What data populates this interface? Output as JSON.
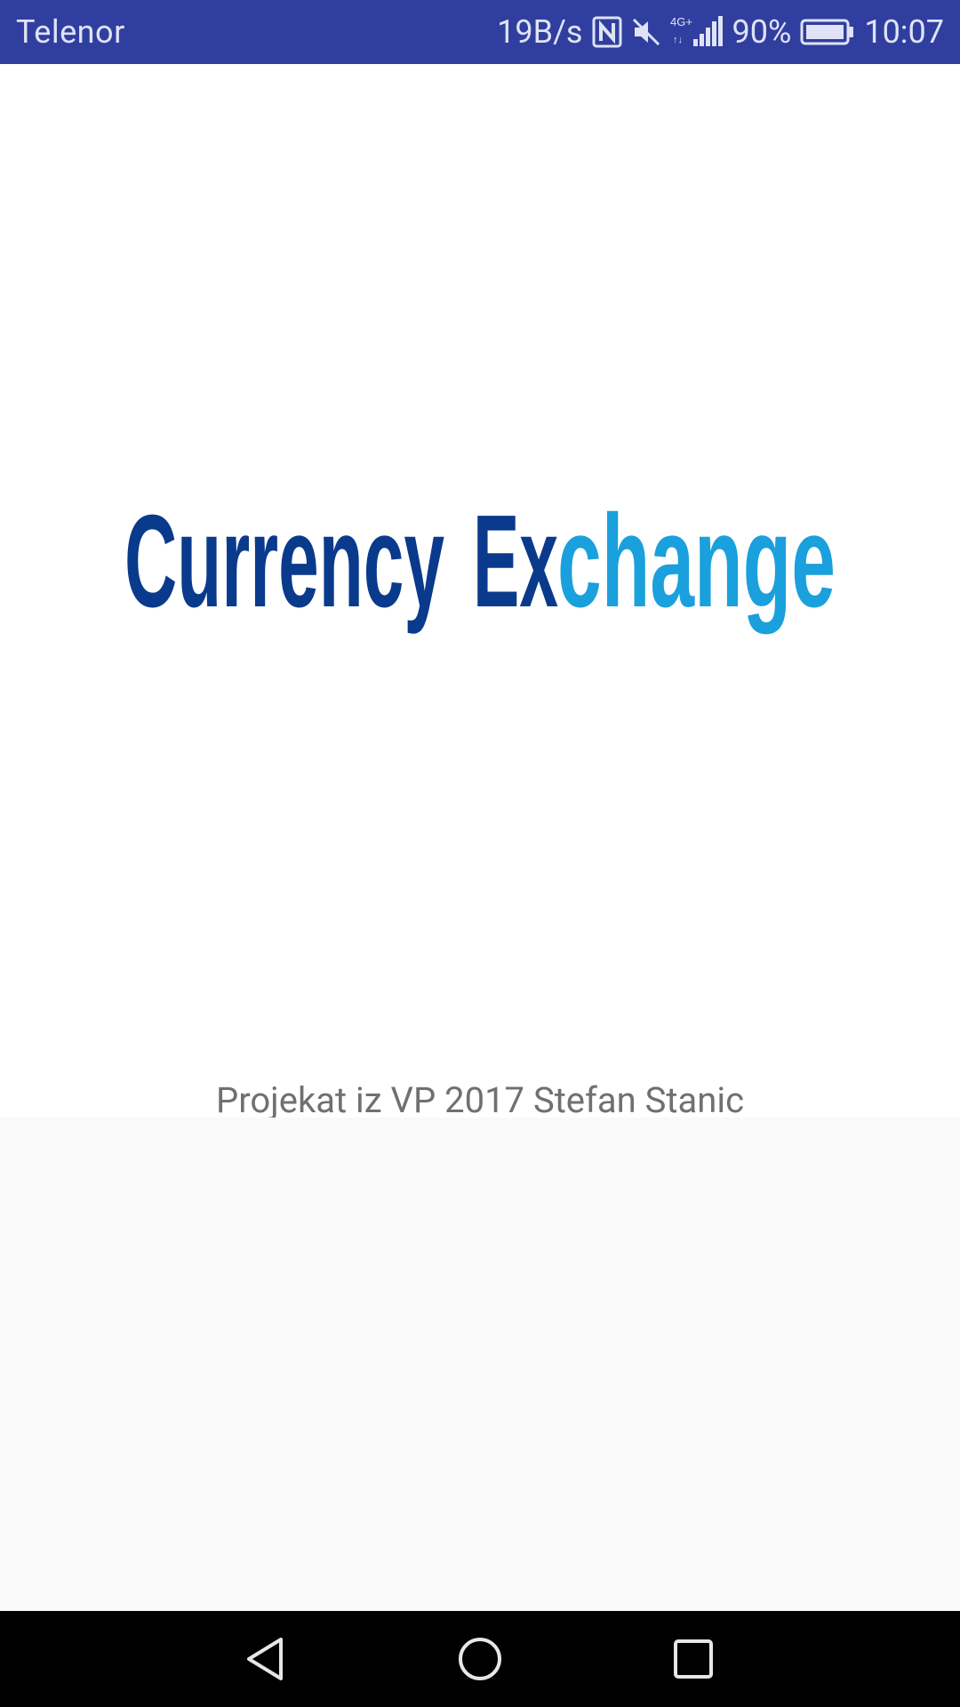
{
  "status_bar": {
    "carrier": "Telenor",
    "data_speed": "19B/s",
    "battery_percent": "90%",
    "time": "10:07",
    "network_type": "4G+",
    "icons": [
      "nfc-icon",
      "muted-icon",
      "signal-icon",
      "battery-icon"
    ],
    "background_color": "#303f9f"
  },
  "logo": {
    "word1": "Currency",
    "word2_part1": "Ex",
    "word2_part2": "change",
    "color_dark": "#0a3a8c",
    "color_light": "#1aa0dc"
  },
  "credit_text": "Projekat iz VP 2017 Stefan Stanic",
  "nav_bar": {
    "icons": [
      "back-icon",
      "home-icon",
      "recent-apps-icon"
    ]
  }
}
